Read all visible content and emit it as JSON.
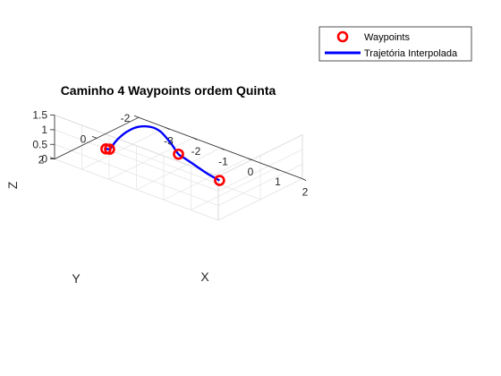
{
  "chart_data": {
    "type": "line",
    "projection": "3d",
    "title": "Caminho 4 Waypoints ordem Quinta",
    "xlabel": "X",
    "ylabel": "Y",
    "zlabel": "Z",
    "xlim": [
      -4,
      2
    ],
    "ylim": [
      -2,
      2
    ],
    "zlim": [
      0,
      1.5
    ],
    "xticks": [
      "-3",
      "-2",
      "-1",
      "0",
      "1",
      "2"
    ],
    "yticks": [
      "-2",
      "0",
      "2"
    ],
    "zticks": [
      "0",
      "0.5",
      "1",
      "1.5"
    ],
    "grid": true,
    "legend_position": "top-right",
    "colors": {
      "waypoints": "#ff0000",
      "trajectory": "#0000ff",
      "grid": "#e6e6e6",
      "box": "#d8d8d8"
    },
    "series": [
      {
        "name": "Waypoints",
        "style": "markers",
        "points": [
          {
            "x": 2.2,
            "y": 2.2,
            "z": 1.5
          },
          {
            "x": -1.0,
            "y": 0.0,
            "z": 0.5
          },
          {
            "x": -1.6,
            "y": 2.5,
            "z": 1.35
          },
          {
            "x": -1.5,
            "y": 2.8,
            "z": 1.5
          }
        ]
      },
      {
        "name": "Trajetória Interpolada",
        "style": "line",
        "points": [
          {
            "x": 2.2,
            "y": 2.2,
            "z": 1.5
          },
          {
            "x": 1.3,
            "y": 1.6,
            "z": 1.2
          },
          {
            "x": 0.4,
            "y": 1.0,
            "z": 0.95
          },
          {
            "x": -0.5,
            "y": 0.4,
            "z": 0.7
          },
          {
            "x": -1.0,
            "y": 0.0,
            "z": 0.5
          },
          {
            "x": -1.9,
            "y": -0.8,
            "z": 0.28
          },
          {
            "x": -2.8,
            "y": -1.5,
            "z": 0.1
          },
          {
            "x": -3.3,
            "y": -1.7,
            "z": 0.02
          },
          {
            "x": -3.55,
            "y": -1.4,
            "z": 0.05
          },
          {
            "x": -3.4,
            "y": -0.7,
            "z": 0.2
          },
          {
            "x": -3.0,
            "y": 0.2,
            "z": 0.45
          },
          {
            "x": -2.5,
            "y": 1.1,
            "z": 0.75
          },
          {
            "x": -2.0,
            "y": 1.9,
            "z": 1.05
          },
          {
            "x": -1.6,
            "y": 2.5,
            "z": 1.35
          },
          {
            "x": -1.5,
            "y": 2.8,
            "z": 1.5
          }
        ]
      }
    ]
  }
}
